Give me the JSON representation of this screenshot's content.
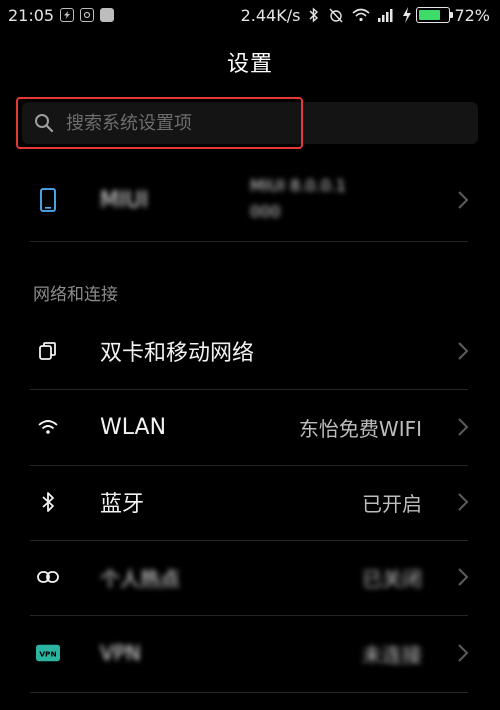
{
  "status_bar": {
    "time": "21:05",
    "speed": "2.44K/s",
    "battery_percent": "72%",
    "battery_level": 0.72,
    "icons": [
      "lightning-square-icon",
      "notification-square-icon",
      "image-square-icon",
      "bluetooth-icon",
      "alarm-off-icon",
      "wifi-icon",
      "signal-icon",
      "charging-icon",
      "battery-icon"
    ]
  },
  "header": {
    "title": "设置"
  },
  "search": {
    "placeholder": "搜索系统设置项"
  },
  "account": {
    "name": "MIUI",
    "detail_line1": "MIUI 8.0.0.1",
    "detail_line2": "000",
    "icon": "phone-icon"
  },
  "section": {
    "network_title": "网络和连接"
  },
  "items": [
    {
      "label": "双卡和移动网络",
      "value": "",
      "icon": "dual-sim-icon"
    },
    {
      "label": "WLAN",
      "value": "东怡免费WIFI",
      "icon": "wifi-icon"
    },
    {
      "label": "蓝牙",
      "value": "已开启",
      "icon": "bluetooth-icon"
    },
    {
      "label": "个人热点",
      "value": "已关闭",
      "icon": "link-icon"
    },
    {
      "label": "VPN",
      "value": "未连接",
      "icon": "vpn-icon"
    }
  ],
  "colors": {
    "background": "#000000",
    "accent_red": "#e53935",
    "battery_green": "#3ddc68",
    "vpn_badge": "#2bb5a0"
  }
}
